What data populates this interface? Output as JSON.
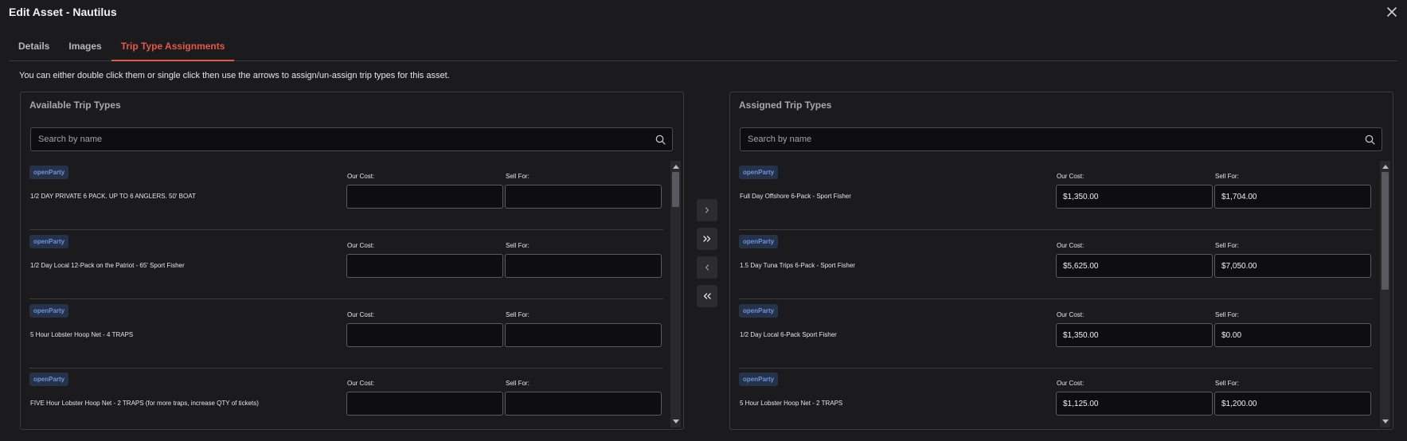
{
  "modal": {
    "title": "Edit Asset - Nautilus"
  },
  "tabs": [
    {
      "label": "Details",
      "active": false
    },
    {
      "label": "Images",
      "active": false
    },
    {
      "label": "Trip Type Assignments",
      "active": true
    }
  ],
  "help_text": "You can either double click them or single click then use the arrows to assign/un-assign trip types for this asset.",
  "available": {
    "title": "Available Trip Types",
    "search_placeholder": "Search by name",
    "cost_label": "Our Cost:",
    "sell_label": "Sell For:",
    "items": [
      {
        "badge": "openParty",
        "name": "1/2 DAY PRIVATE 6 PACK. UP TO 6 ANGLERS. 50' BOAT",
        "cost": "",
        "sell": ""
      },
      {
        "badge": "openParty",
        "name": "1/2 Day Local 12-Pack on the Patriot - 65' Sport Fisher",
        "cost": "",
        "sell": ""
      },
      {
        "badge": "openParty",
        "name": "5 Hour Lobster Hoop Net - 4 TRAPS",
        "cost": "",
        "sell": ""
      },
      {
        "badge": "openParty",
        "name": "FIVE Hour Lobster Hoop Net - 2 TRAPS (for more traps, increase QTY of tickets)",
        "cost": "",
        "sell": ""
      }
    ]
  },
  "assigned": {
    "title": "Assigned Trip Types",
    "search_placeholder": "Search by name",
    "cost_label": "Our Cost:",
    "sell_label": "Sell For:",
    "items": [
      {
        "badge": "openParty",
        "name": "Full Day Offshore 6-Pack - Sport Fisher",
        "cost": "$1,350.00",
        "sell": "$1,704.00"
      },
      {
        "badge": "openParty",
        "name": "1.5 Day Tuna Trips 6-Pack - Sport Fisher",
        "cost": "$5,625.00",
        "sell": "$7,050.00"
      },
      {
        "badge": "openParty",
        "name": "1/2 Day Local 6-Pack Sport Fisher",
        "cost": "$1,350.00",
        "sell": "$0.00"
      },
      {
        "badge": "openParty",
        "name": "5 Hour Lobster Hoop Net - 2 TRAPS",
        "cost": "$1,125.00",
        "sell": "$1,200.00"
      }
    ]
  },
  "icons": {
    "close": "close-icon",
    "search": "search-icon",
    "assign_one": "chevron-right-icon",
    "assign_all": "double-chevron-right-icon",
    "unassign_one": "chevron-left-icon",
    "unassign_all": "double-chevron-left-icon"
  },
  "colors": {
    "accent": "#e05a4b",
    "badge_bg": "#26324a",
    "badge_text": "#6d93d8",
    "background": "#1b1b1d"
  }
}
